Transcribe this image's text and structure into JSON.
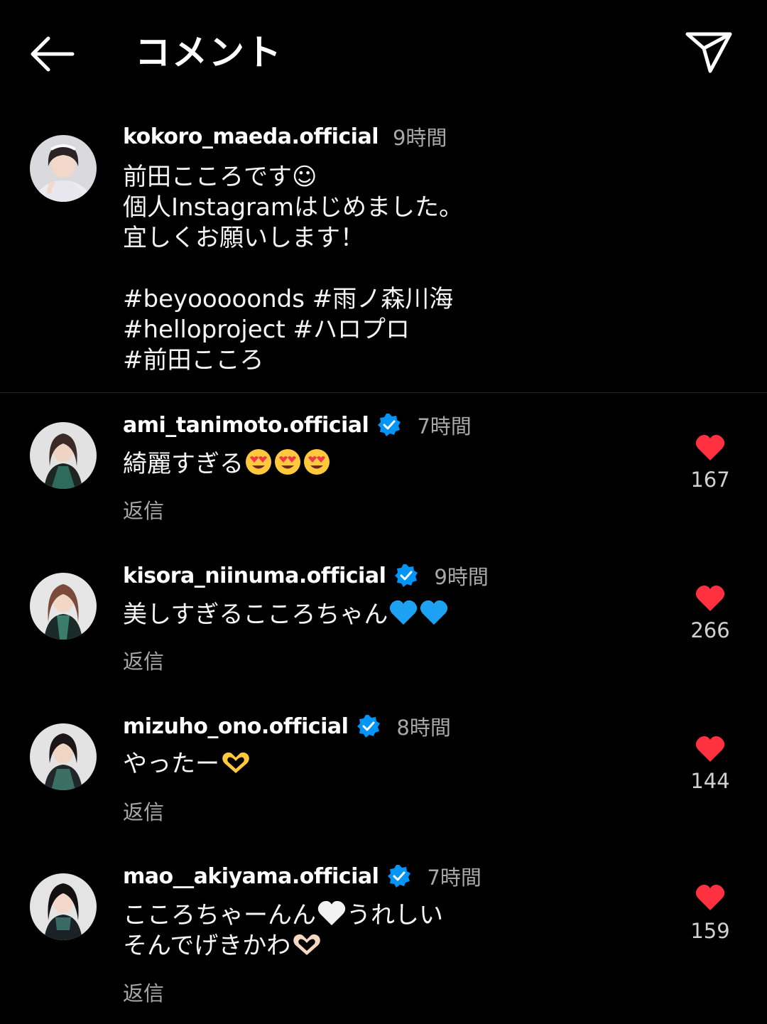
{
  "header": {
    "title": "コメント"
  },
  "caption": {
    "username": "kokoro_maeda.official",
    "time": "9時間",
    "lines": [
      "前田こころです☺︎",
      "個人Instagramはじめました。",
      "宜しくお願いします！"
    ],
    "hashtags_line1": [
      "#beyooooonds",
      "#雨ノ森川海"
    ],
    "hashtags_line2": [
      "#helloproject",
      "#ハロプロ"
    ],
    "hashtags_line3": [
      "#前田こころ"
    ]
  },
  "comments": [
    {
      "username": "ami_tanimoto.official",
      "time": "7時間",
      "text": "綺麗すぎる",
      "emojis": [
        "heart-eyes",
        "heart-eyes",
        "heart-eyes"
      ],
      "reply": "返信",
      "likes": "167"
    },
    {
      "username": "kisora_niinuma.official",
      "time": "9時間",
      "text": "美しすぎるこころちゃん",
      "emojis": [
        "blue-heart",
        "blue-heart"
      ],
      "reply": "返信",
      "likes": "266"
    },
    {
      "username": "mizuho_ono.official",
      "time": "8時間",
      "text": "やったー",
      "emojis": [
        "heart-hands"
      ],
      "reply": "返信",
      "likes": "144"
    },
    {
      "username": "mao__akiyama.official",
      "time": "7時間",
      "text_line1_a": "こころちゃーんん",
      "text_line1_b": "うれしい",
      "text_line2": "そんでげきかわ",
      "emojis": [
        "white-heart",
        "heart-hands"
      ],
      "reply": "返信",
      "likes": "159"
    }
  ],
  "colors": {
    "background": "#000000",
    "text_primary": "#f5f5f5",
    "text_secondary": "#a8a8a8",
    "verified": "#0095f6",
    "like_heart": "#ff3040",
    "divider": "#262626"
  }
}
